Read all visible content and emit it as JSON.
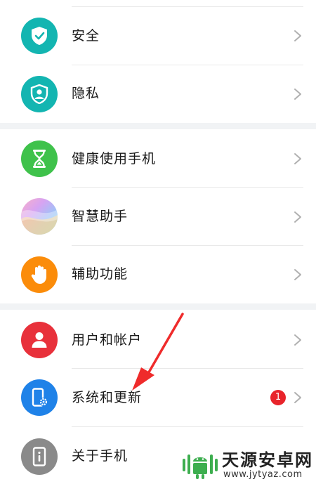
{
  "settings": {
    "group1": [
      {
        "label": "安全",
        "icon": "shield-check-icon",
        "color": "#13b5b1"
      },
      {
        "label": "隐私",
        "icon": "privacy-person-icon",
        "color": "#13b5b1"
      }
    ],
    "group2": [
      {
        "label": "健康使用手机",
        "icon": "hourglass-icon",
        "color": "#3fc24b"
      },
      {
        "label": "智慧助手",
        "icon": "assistant-orb-icon",
        "color": "#c9a7f0"
      },
      {
        "label": "辅助功能",
        "icon": "hand-icon",
        "color": "#fb8c0a"
      }
    ],
    "group3": [
      {
        "label": "用户和帐户",
        "icon": "user-icon",
        "color": "#e8313b"
      },
      {
        "label": "系统和更新",
        "icon": "phone-gear-icon",
        "color": "#1f82e8",
        "badge": "1"
      },
      {
        "label": "关于手机",
        "icon": "phone-info-icon",
        "color": "#8a8a8a"
      }
    ]
  },
  "watermark": {
    "title": "天源安卓网",
    "url": "www.jytyaz.com"
  }
}
